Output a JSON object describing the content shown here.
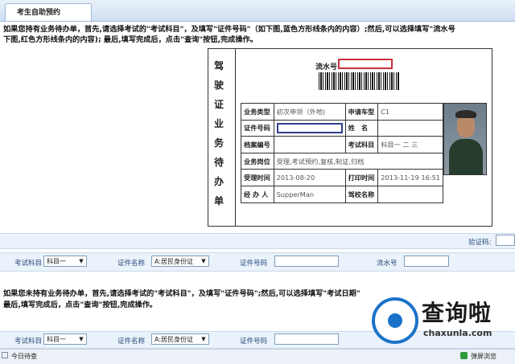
{
  "tab": {
    "label": "考生自助预约"
  },
  "instructions_top": {
    "line1": "如果您持有业务待办单，首先,请选择考试的\"考试科目\"，及填写\"证件号码\"（如下图,蓝色方形线条内的内容）;然后,可以选择填写\"流水号",
    "line2": "下图,红色方形线条内的内容); 最后,填写完成后，点击\"查询\"按钮,完成操作。"
  },
  "certificate": {
    "vertical_title": [
      "驾",
      "驶",
      "证",
      "业",
      "务",
      "待",
      "办",
      "单"
    ],
    "serial_label": "流水号",
    "rows": [
      [
        {
          "t": "业务类型",
          "l": true
        },
        {
          "t": "初次申领（外地)",
          "l": false
        },
        {
          "t": "申请车型",
          "l": true
        },
        {
          "t": "C1",
          "l": false
        }
      ],
      [
        {
          "t": "证件号码",
          "l": true
        },
        {
          "t": "",
          "l": false,
          "box": true
        },
        {
          "t": "姓　名",
          "l": true
        },
        {
          "t": "",
          "l": false
        }
      ],
      [
        {
          "t": "档案编号",
          "l": true
        },
        {
          "t": "",
          "l": false
        },
        {
          "t": "考试科目",
          "l": true
        },
        {
          "t": "科目一 二 三",
          "l": false
        }
      ],
      [
        {
          "t": "业务岗位",
          "l": true
        },
        {
          "t": "受理,考试预约,复核,制证,归档",
          "l": false,
          "span": 3
        }
      ],
      [
        {
          "t": "受理时间",
          "l": true
        },
        {
          "t": "2013-08-20",
          "l": false
        },
        {
          "t": "打印时间",
          "l": true
        },
        {
          "t": "2013-11-19 16:51",
          "l": false
        }
      ],
      [
        {
          "t": "经 办 人",
          "l": true
        },
        {
          "t": "SupperMan",
          "l": false
        },
        {
          "t": "驾校名称",
          "l": true
        },
        {
          "t": "",
          "l": false
        }
      ]
    ]
  },
  "form1": {
    "captcha_label": "验证码:",
    "subject_label": "考试科目",
    "subject_value": "科目一",
    "cert_name_label": "证件名称",
    "cert_name_value": "A:居民身份证",
    "cert_no_label": "证件号码",
    "serial_label": "流水号"
  },
  "instructions_mid": {
    "line1": "如果您未持有业务待办单，首先,请选择考试的\"考试科目\"，及填写\"证件号码\";然后,可以选择填写\"考试日期\"",
    "line2": "最后,填写完成后，点击\"查询\"按钮,完成操作。"
  },
  "form2": {
    "subject_label": "考试科目",
    "subject_value": "科目一",
    "cert_name_label": "证件名称",
    "cert_name_value": "A:居民身份证",
    "cert_no_label": "证件号码"
  },
  "footer": {
    "left": "今日待查",
    "right": "弹屏浏览"
  },
  "watermark": {
    "cn": "查询啦",
    "en": "chaxunla.com"
  },
  "colors": {
    "serial_box": "#c8303c",
    "id_box": "#2d3f8f",
    "accent": "#1a73c8"
  }
}
